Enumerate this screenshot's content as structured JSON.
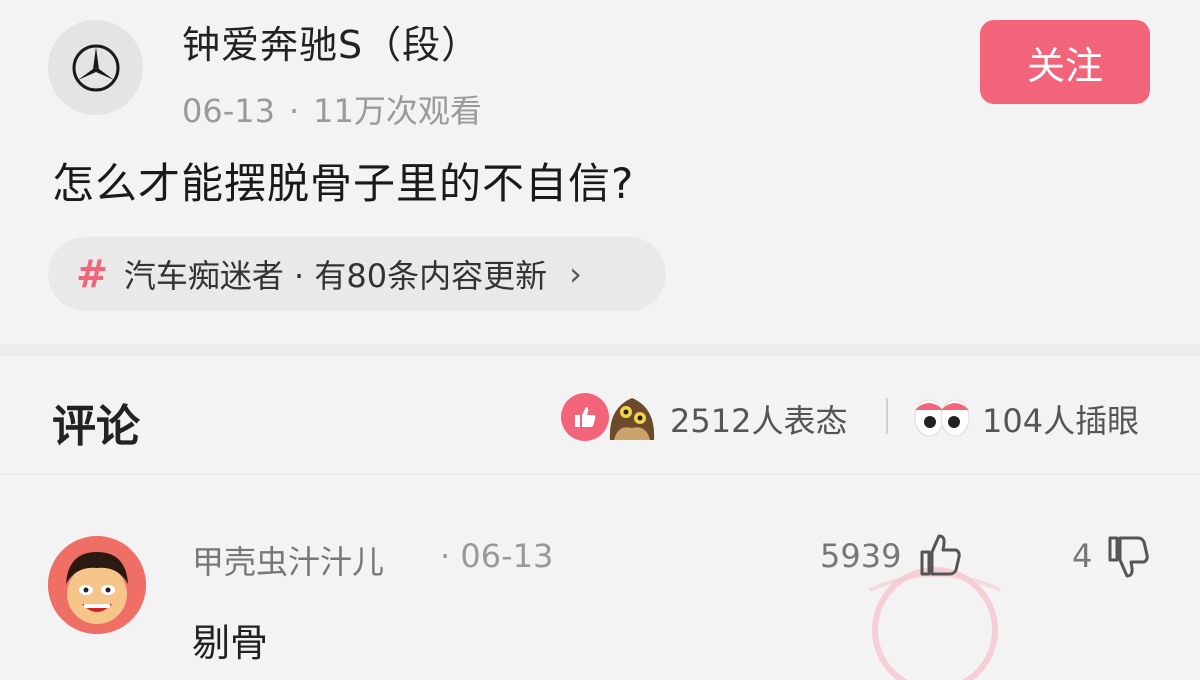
{
  "post": {
    "author": "钟爱奔驰S（段）",
    "date": "06-13",
    "separator": "·",
    "views": "11万次观看",
    "follow_label": "关注",
    "title": "怎么才能摆脱骨子里的不自信?",
    "topic": {
      "hash": "#",
      "text": "汽车痴迷者 · 有80条内容更新",
      "chevron": "›"
    }
  },
  "comments_section": {
    "title": "评论",
    "reactions_count": "2512人表态",
    "peek_count": "104人插眼"
  },
  "comment": {
    "user": "甲壳虫汁汁儿",
    "date": "· 06-13",
    "likes": "5939",
    "dislikes": "4",
    "text": "剔骨"
  },
  "colors": {
    "accent": "#f2647a",
    "background": "#f3f3f3"
  },
  "icons": [
    "mercedes-logo-icon",
    "hash-icon",
    "chevron-right-icon",
    "thumbs-up-reaction-icon",
    "owl-reaction-icon",
    "eyes-icon",
    "thumbs-up-icon",
    "thumbs-down-icon",
    "featured-stamp-icon"
  ]
}
